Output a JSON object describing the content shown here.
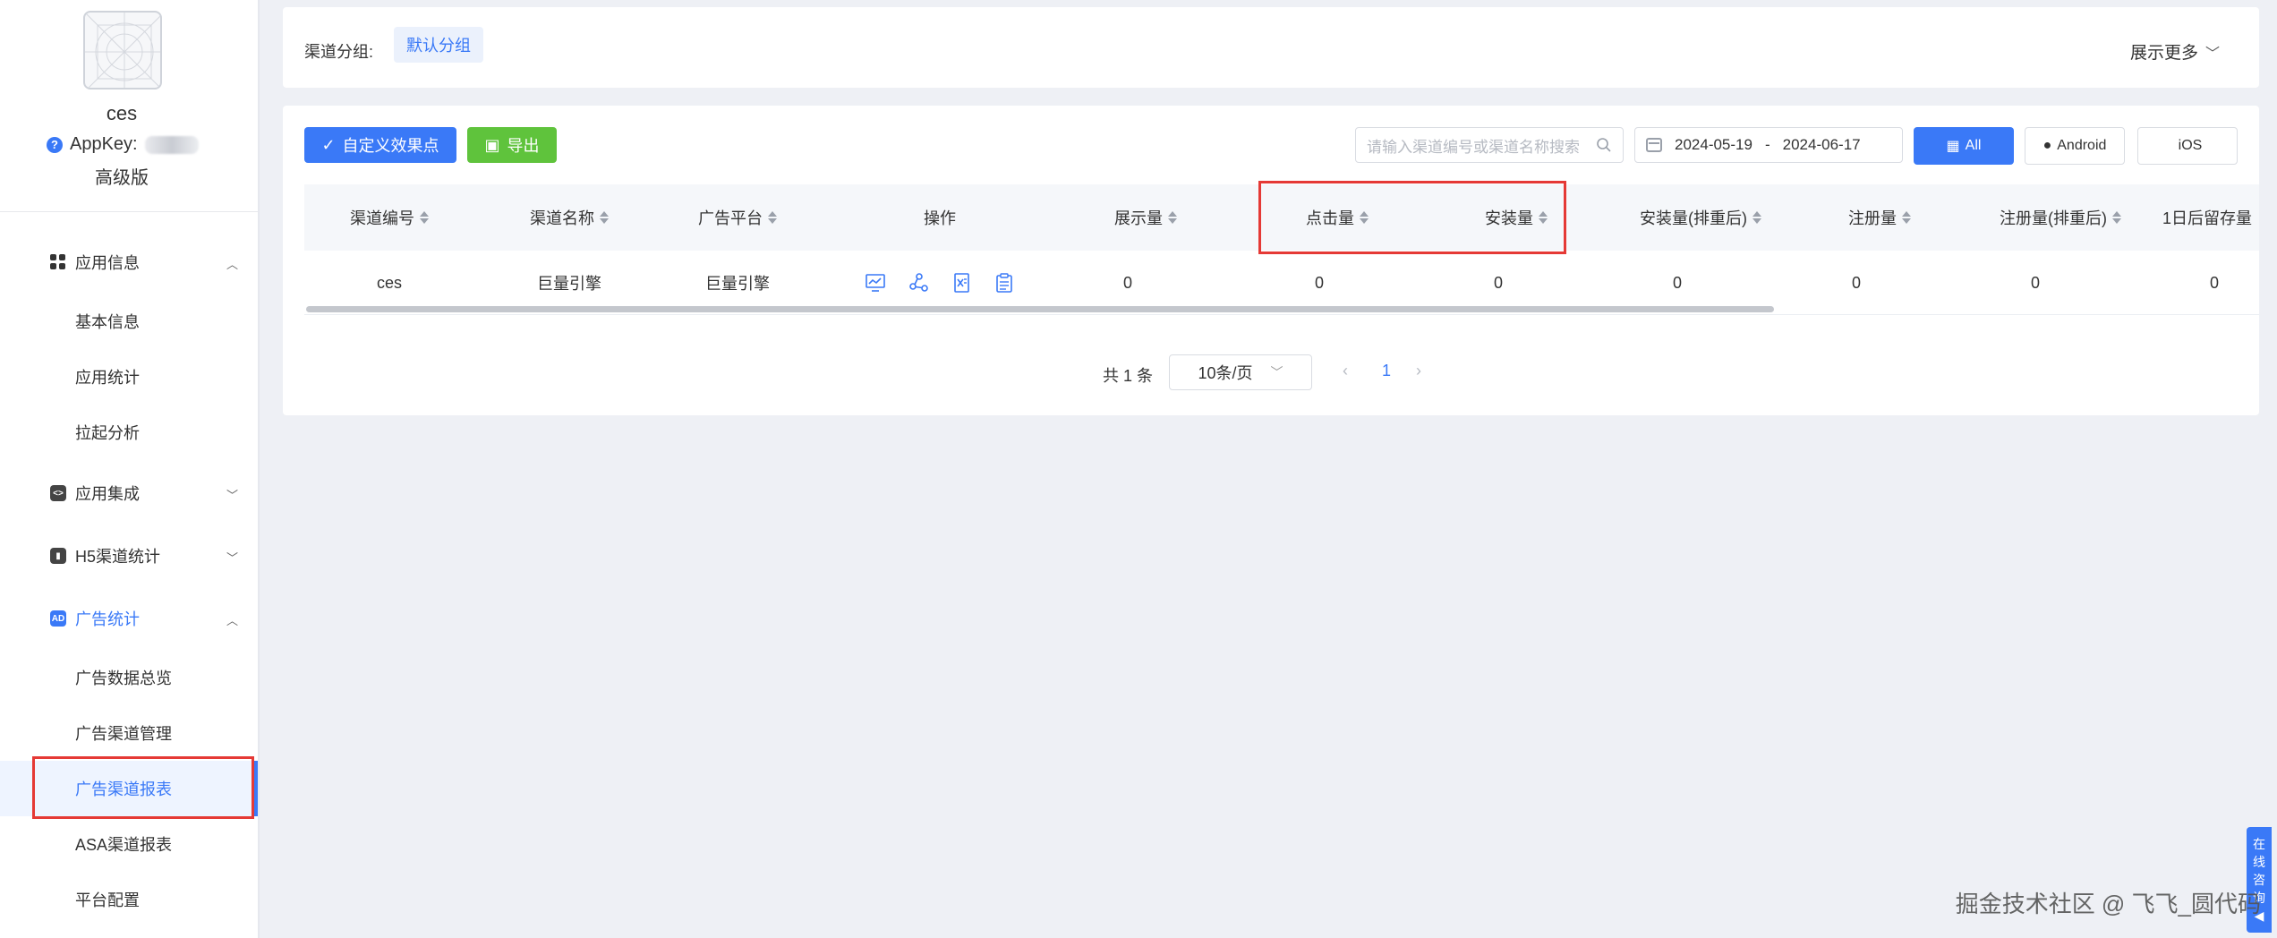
{
  "sidebar": {
    "app_name": "ces",
    "appkey_label": "AppKey:",
    "plan": "高级版",
    "groups": [
      {
        "label": "应用信息",
        "expanded": true
      },
      {
        "label": "应用集成",
        "expanded": false
      },
      {
        "label": "H5渠道统计",
        "expanded": false
      },
      {
        "label": "广告统计",
        "expanded": true
      }
    ],
    "items": {
      "basic_info": "基本信息",
      "app_stats": "应用统计",
      "launch_analysis": "拉起分析",
      "ad_overview": "广告数据总览",
      "ad_channel_mgmt": "广告渠道管理",
      "ad_channel_report": "广告渠道报表",
      "asa_report": "ASA渠道报表",
      "platform_config": "平台配置"
    },
    "icon_codes": {
      "integration": "<>",
      "h5": "H5",
      "ad": "AD"
    }
  },
  "filter": {
    "label": "渠道分组:",
    "tag": "默认分组",
    "show_more": "展示更多"
  },
  "toolbar": {
    "custom_btn": "自定义效果点",
    "export_btn": "导出",
    "search_placeholder": "请输入渠道编号或渠道名称搜索",
    "date_start": "2024-05-19",
    "date_sep": "-",
    "date_end": "2024-06-17",
    "seg_all": "All",
    "seg_android": "Android",
    "seg_ios": "iOS"
  },
  "table": {
    "columns": [
      "渠道编号",
      "渠道名称",
      "广告平台",
      "操作",
      "展示量",
      "点击量",
      "安装量",
      "安装量(排重后)",
      "注册量",
      "注册量(排重后)",
      "1日后留存量"
    ],
    "rows": [
      {
        "channel_id": "ces",
        "channel_name": "巨量引擎",
        "platform": "巨量引擎",
        "impressions": "0",
        "clicks": "0",
        "installs": "0",
        "installs_dedup": "0",
        "registrations": "0",
        "registrations_dedup": "0",
        "retention_1d": "0"
      }
    ]
  },
  "pagination": {
    "total": "共 1 条",
    "page_size": "10条/页",
    "current": "1"
  },
  "floating": {
    "consult": [
      "在",
      "线",
      "咨",
      "询",
      "◀"
    ]
  },
  "watermark": "掘金技术社区 @ 飞飞_圆代码",
  "colors": {
    "primary": "#3a79f7",
    "export": "#5fc33c",
    "highlight": "#e53935"
  }
}
